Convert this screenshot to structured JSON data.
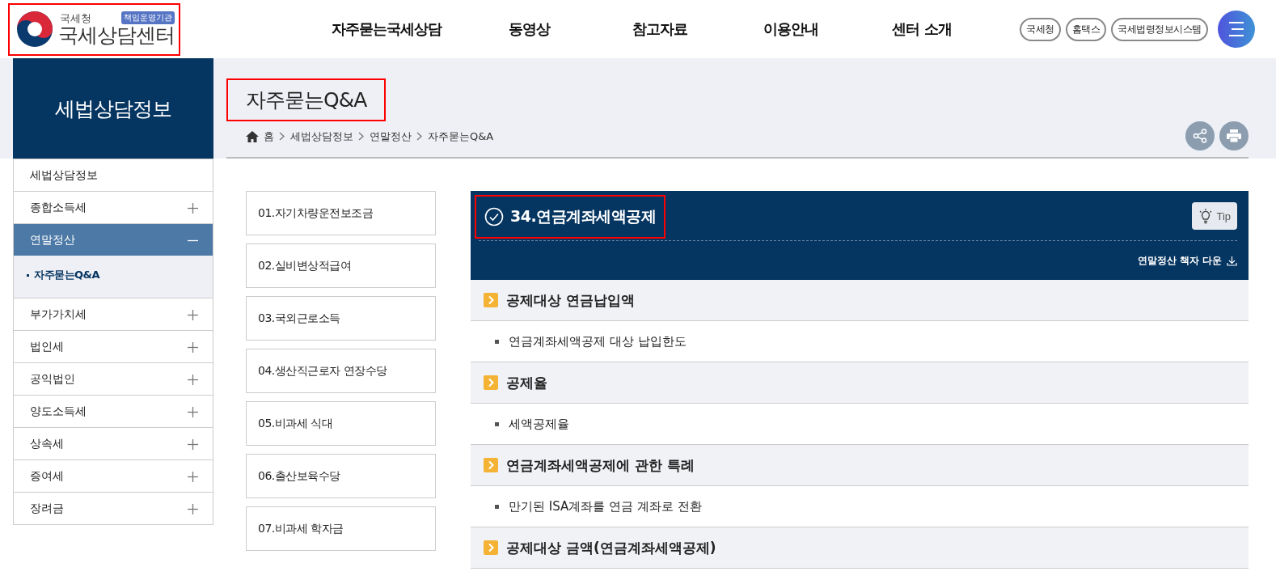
{
  "header": {
    "logo": {
      "org": "국세청",
      "name": "국세상담센터",
      "badge": "책임운영기관",
      "highlighted": true
    },
    "nav": [
      "자주묻는국세상담",
      "동영상",
      "참고자료",
      "이용안내",
      "센터 소개"
    ],
    "links": [
      "국세청",
      "홈택스",
      "국세법령정보시스템"
    ]
  },
  "sidebar": {
    "title": "세법상담정보",
    "items": [
      {
        "label": "세법상담정보",
        "kind": "heading",
        "selected": false
      },
      {
        "label": "종합소득세",
        "kind": "group",
        "expanded": false,
        "selected": false
      },
      {
        "label": "연말정산",
        "kind": "group",
        "expanded": true,
        "selected": true,
        "children": [
          {
            "label": "자주묻는Q&A",
            "selected": true
          }
        ]
      },
      {
        "label": "부가가치세",
        "kind": "group",
        "expanded": false,
        "selected": false
      },
      {
        "label": "법인세",
        "kind": "group",
        "expanded": false,
        "selected": false
      },
      {
        "label": "공익법인",
        "kind": "group",
        "expanded": false,
        "selected": false
      },
      {
        "label": "양도소득세",
        "kind": "group",
        "expanded": false,
        "selected": false
      },
      {
        "label": "상속세",
        "kind": "group",
        "expanded": false,
        "selected": false
      },
      {
        "label": "증여세",
        "kind": "group",
        "expanded": false,
        "selected": false
      },
      {
        "label": "장려금",
        "kind": "group",
        "expanded": false,
        "selected": false
      }
    ]
  },
  "page": {
    "title": "자주묻는Q&A",
    "title_highlighted": true,
    "breadcrumb": [
      "홈",
      "세법상담정보",
      "연말정산",
      "자주묻는Q&A"
    ]
  },
  "qa_list": [
    "01.자기차량운전보조금",
    "02.실비변상적급여",
    "03.국외근로소득",
    "04.생산직근로자 연장수당",
    "05.비과세 식대",
    "06.출산보육수당",
    "07.비과세 학자금"
  ],
  "detail": {
    "title": "34.연금계좌세액공제",
    "highlighted": true,
    "tip": "Tip",
    "download": "연말정산 책자 다운",
    "rows": [
      {
        "kind": "section",
        "text": "공제대상 연금납입액"
      },
      {
        "kind": "item",
        "text": "연금계좌세액공제 대상 납입한도"
      },
      {
        "kind": "section",
        "text": "공제율"
      },
      {
        "kind": "item",
        "text": "세액공제율"
      },
      {
        "kind": "section",
        "text": "연금계좌세액공제에 관한 특례"
      },
      {
        "kind": "item",
        "text": "만기된 ISA계좌를 연금 계좌로 전환"
      },
      {
        "kind": "section",
        "text": "공제대상 금액(연금계좌세액공제)"
      }
    ]
  }
}
